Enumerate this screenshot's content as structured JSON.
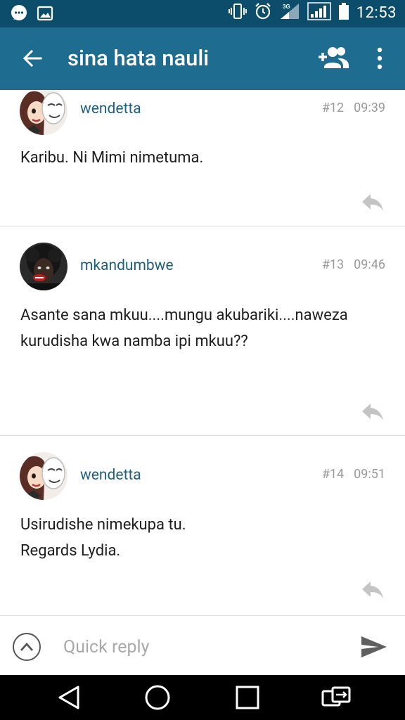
{
  "status_bar": {
    "time": "12:53",
    "network_label": "3G",
    "icons": [
      "chat-bubble-icon",
      "image-icon",
      "vibrate-icon",
      "alarm-icon",
      "signal-3g-icon",
      "signal-icon",
      "battery-icon"
    ]
  },
  "app_bar": {
    "title": "sina hata nauli",
    "icons": [
      "back-arrow-icon",
      "add-user-icon",
      "more-vert-icon"
    ]
  },
  "posts": [
    {
      "username": "wendetta",
      "post_number": "#12",
      "time": "09:39",
      "body": [
        "Karibu. Ni Mimi nimetuma."
      ]
    },
    {
      "username": "mkandumbwe",
      "post_number": "#13",
      "time": "09:46",
      "body": [
        "Asante sana mkuu....mungu akubariki....naweza kurudisha kwa namba ipi mkuu??"
      ]
    },
    {
      "username": "wendetta",
      "post_number": "#14",
      "time": "09:51",
      "body": [
        "Usirudishe nimekupa tu.",
        "Regards Lydia."
      ]
    }
  ],
  "quick_reply": {
    "placeholder": "Quick reply",
    "value": ""
  },
  "nav_bar": {
    "icons": [
      "nav-back-icon",
      "nav-home-icon",
      "nav-recents-icon",
      "nav-switch-icon"
    ]
  },
  "colors": {
    "status_bar": "#0b4d6a",
    "app_bar": "#1e6d91",
    "username": "#1f5f7e",
    "meta": "#9a9a9a",
    "divider": "#d7d7d7"
  }
}
